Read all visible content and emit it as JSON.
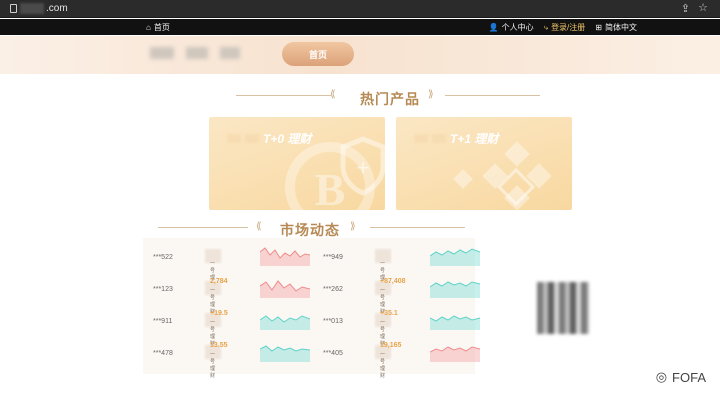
{
  "browser": {
    "url_suffix": ".com"
  },
  "topnav": {
    "home": "首页",
    "user_center": "个人中心",
    "login": "登录/注册",
    "language": "简体中文"
  },
  "header": {
    "home_pill": "首页"
  },
  "sections": {
    "hot_products": "热门产品",
    "market": "市场动态"
  },
  "cards": [
    {
      "title": "T+0 理财"
    },
    {
      "title": "T+1 理财"
    }
  ],
  "market": {
    "left": [
      {
        "user": "***522",
        "value": "",
        "product": "一号理财",
        "trend": "red"
      },
      {
        "user": "***123",
        "value": "2,784",
        "product": "一号理财",
        "trend": "red"
      },
      {
        "user": "***911",
        "value": "+19.5",
        "product": "一号理财",
        "trend": "teal"
      },
      {
        "user": "***478",
        "value": "13.55",
        "product": "一号理财",
        "trend": "teal"
      }
    ],
    "right": [
      {
        "user": "***949",
        "value": "",
        "product": "一号理财",
        "trend": "teal"
      },
      {
        "user": "***262",
        "value": "+87,408",
        "product": "一号理财",
        "trend": "teal"
      },
      {
        "user": "***013",
        "value": "+35.1",
        "product": "一号理财",
        "trend": "teal"
      },
      {
        "user": "***405",
        "value": "19,165",
        "product": "一号理财",
        "trend": "red"
      }
    ]
  },
  "watermark": {
    "text": "FOFA"
  },
  "colors": {
    "red": "#f08b8b",
    "teal": "#5ed3c9",
    "gold": "#e7a34a"
  }
}
